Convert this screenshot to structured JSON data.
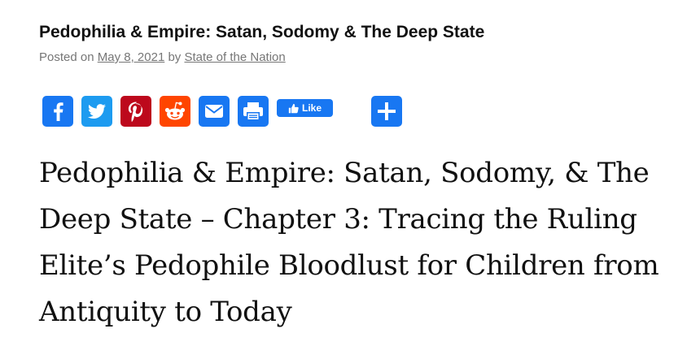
{
  "post": {
    "title": "Pedophilia & Empire: Satan, Sodomy & The Deep State",
    "meta_prefix": "Posted on",
    "date": "May 8, 2021",
    "by_text": "by",
    "author": "State of the Nation"
  },
  "share": {
    "like_label": "Like",
    "colors": {
      "facebook": "#1877f2",
      "twitter": "#1d9bf0",
      "pinterest": "#bd081c",
      "reddit": "#ff4500",
      "email": "#1877f2",
      "print": "#1877f2",
      "more": "#1877f2"
    },
    "icons": [
      "facebook-icon",
      "twitter-icon",
      "pinterest-icon",
      "reddit-icon",
      "email-icon",
      "print-icon",
      "like-icon",
      "plus-icon"
    ]
  },
  "headline": {
    "lines": [
      "Pedophilia & Empire: Satan, Sodomy, & The",
      "Deep State – Chapter 3: Tracing the Ruling",
      "Elite’s Pedophile Bloodlust for Children from",
      "Antiquity to Today"
    ]
  }
}
